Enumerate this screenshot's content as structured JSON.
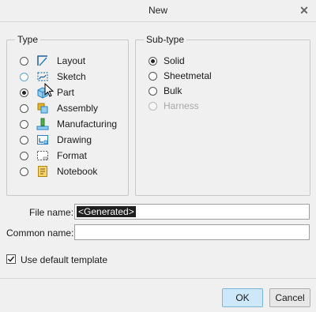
{
  "window": {
    "title": "New",
    "close_glyph": "✕"
  },
  "type_group": {
    "legend": "Type",
    "items": [
      {
        "label": "Layout",
        "icon": "layout-icon",
        "selected": false
      },
      {
        "label": "Sketch",
        "icon": "sketch-icon",
        "selected": false,
        "hovered": true
      },
      {
        "label": "Part",
        "icon": "part-icon",
        "selected": true
      },
      {
        "label": "Assembly",
        "icon": "assembly-icon",
        "selected": false
      },
      {
        "label": "Manufacturing",
        "icon": "manufacturing-icon",
        "selected": false
      },
      {
        "label": "Drawing",
        "icon": "drawing-icon",
        "selected": false
      },
      {
        "label": "Format",
        "icon": "format-icon",
        "selected": false
      },
      {
        "label": "Notebook",
        "icon": "notebook-icon",
        "selected": false
      }
    ]
  },
  "subtype_group": {
    "legend": "Sub-type",
    "items": [
      {
        "label": "Solid",
        "selected": true,
        "disabled": false
      },
      {
        "label": "Sheetmetal",
        "selected": false,
        "disabled": false
      },
      {
        "label": "Bulk",
        "selected": false,
        "disabled": false
      },
      {
        "label": "Harness",
        "selected": false,
        "disabled": true
      }
    ]
  },
  "file_name": {
    "label": "File name:",
    "value": "<Generated>"
  },
  "common_name": {
    "label": "Common name:",
    "value": ""
  },
  "default_template": {
    "label": "Use default template",
    "checked": true
  },
  "buttons": {
    "ok": "OK",
    "cancel": "Cancel"
  },
  "colors": {
    "accent": "#cde8fa",
    "icon_blue": "#2d7fc1",
    "icon_yellow": "#e6b422"
  }
}
